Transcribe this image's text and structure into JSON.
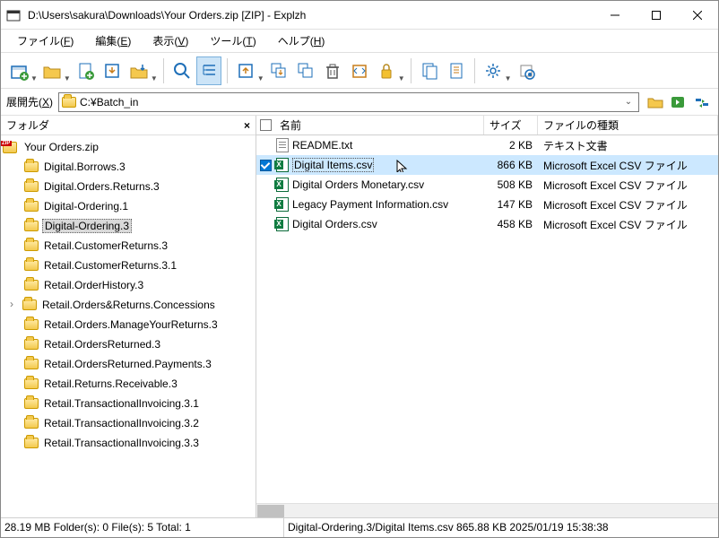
{
  "window": {
    "title": "D:\\Users\\sakura\\Downloads\\Your Orders.zip [ZIP] - Explzh"
  },
  "menu": {
    "file": "ファイル(F)",
    "edit": "編集(E)",
    "view": "表示(V)",
    "tools": "ツール(T)",
    "help": "ヘルプ(H)"
  },
  "pathbar": {
    "label": "展開先(X)",
    "value": "C:¥Batch_in"
  },
  "tree": {
    "header": "フォルダ",
    "root": "Your Orders.zip",
    "items": [
      {
        "name": "Digital.Borrows.3"
      },
      {
        "name": "Digital.Orders.Returns.3"
      },
      {
        "name": "Digital-Ordering.1"
      },
      {
        "name": "Digital-Ordering.3",
        "selected": true
      },
      {
        "name": "Retail.CustomerReturns.3"
      },
      {
        "name": "Retail.CustomerReturns.3.1"
      },
      {
        "name": "Retail.OrderHistory.3"
      },
      {
        "name": "Retail.Orders&Returns.Concessions",
        "expandable": true
      },
      {
        "name": "Retail.Orders.ManageYourReturns.3"
      },
      {
        "name": "Retail.OrdersReturned.3"
      },
      {
        "name": "Retail.OrdersReturned.Payments.3"
      },
      {
        "name": "Retail.Returns.Receivable.3"
      },
      {
        "name": "Retail.TransactionalInvoicing.3.1"
      },
      {
        "name": "Retail.TransactionalInvoicing.3.2"
      },
      {
        "name": "Retail.TransactionalInvoicing.3.3"
      }
    ]
  },
  "list": {
    "headers": {
      "name": "名前",
      "size": "サイズ",
      "type": "ファイルの種類"
    },
    "rows": [
      {
        "icon": "txt",
        "name": "README.txt",
        "size": "2 KB",
        "type": "テキスト文書"
      },
      {
        "icon": "csv",
        "name": "Digital Items.csv",
        "size": "866 KB",
        "type": "Microsoft Excel CSV ファイル",
        "selected": true,
        "checked": true
      },
      {
        "icon": "csv",
        "name": "Digital Orders Monetary.csv",
        "size": "508 KB",
        "type": "Microsoft Excel CSV ファイル"
      },
      {
        "icon": "csv",
        "name": "Legacy Payment Information.csv",
        "size": "147 KB",
        "type": "Microsoft Excel CSV ファイル"
      },
      {
        "icon": "csv",
        "name": "Digital Orders.csv",
        "size": "458 KB",
        "type": "Microsoft Excel CSV ファイル"
      }
    ]
  },
  "status": {
    "left": "28.19 MB   Folder(s): 0   File(s): 5   Total: 1",
    "right": "Digital-Ordering.3/Digital Items.csv   865.88 KB   2025/01/19 15:38:38"
  }
}
